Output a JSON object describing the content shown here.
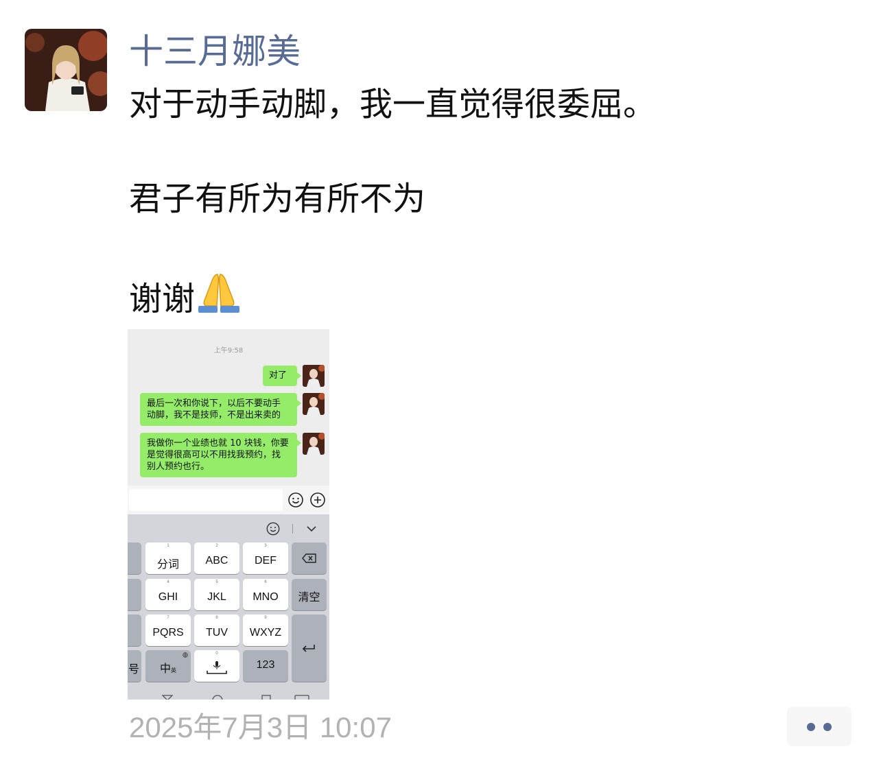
{
  "post": {
    "username": "十三月娜美",
    "line1": "对于动手动脚，我一直觉得很委屈。",
    "line2": "君子有所为有所不为",
    "line3": "谢谢",
    "emoji": "folded-hands",
    "timestamp": "2025年7月3日 10:07"
  },
  "screenshot": {
    "time": "上午9:58",
    "messages": [
      "对了",
      "最后一次和你说下，以后不要动手\n动脚，我不是技师，不是出来卖的",
      "我做你一个业绩也就 10 块钱，你要\n是觉得很高可以不用找我预约，找\n别人预约也行。"
    ],
    "keyboard": {
      "row1": [
        {
          "n": "1",
          "t": "分词"
        },
        {
          "n": "2",
          "t": "ABC"
        },
        {
          "n": "3",
          "t": "DEF"
        }
      ],
      "row2": [
        {
          "n": "4",
          "t": "GHI"
        },
        {
          "n": "5",
          "t": "JKL"
        },
        {
          "n": "6",
          "t": "MNO"
        }
      ],
      "row3": [
        {
          "n": "7",
          "t": "PQRS"
        },
        {
          "n": "8",
          "t": "TUV"
        },
        {
          "n": "9",
          "t": "WXYZ"
        }
      ],
      "clear": "清空",
      "left_partial": "号",
      "zh": "中",
      "zh_sub": "英",
      "space_num": "0",
      "num_key": "123"
    }
  },
  "colors": {
    "username": "#576b95",
    "bubble": "#95ec69",
    "timestamp": "#b2b2b2"
  }
}
